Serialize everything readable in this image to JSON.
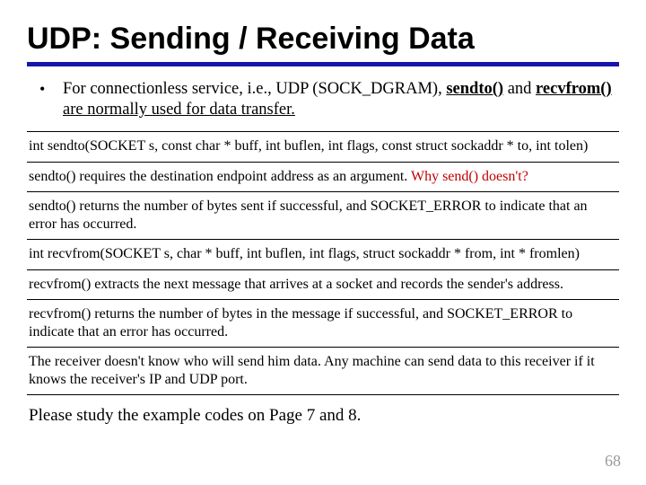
{
  "title": "UDP: Sending / Receiving Data",
  "bullet": {
    "pre": "For connectionless service, i.e., UDP (SOCK_DGRAM), ",
    "fn1": "sendto()",
    "mid": " and ",
    "fn2": "recvfrom()",
    "post": " are normally used for data transfer."
  },
  "blocks": {
    "b1": "int sendto(SOCKET s, const char * buff, int buflen, int flags, const struct sockaddr * to, int tolen)",
    "b2a": "sendto() requires the destination endpoint address as an argument. ",
    "b2b": "Why send() doesn't?",
    "b3": "sendto() returns the number of bytes sent if successful, and SOCKET_ERROR to indicate that an error has occurred.",
    "b4": "int recvfrom(SOCKET s, char * buff, int buflen, int flags, struct sockaddr * from, int * fromlen)",
    "b5": "recvfrom() extracts the next message that arrives at a socket and records the sender's address.",
    "b6": "recvfrom() returns the number of bytes in the message if successful, and SOCKET_ERROR to indicate that an error has occurred.",
    "b7": "The receiver doesn't know who will send him data. Any machine can send data to this receiver if it knows the receiver's IP and UDP port."
  },
  "closing": "Please study the example codes on Page 7 and 8.",
  "page_number": "68"
}
